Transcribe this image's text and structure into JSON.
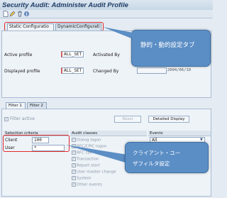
{
  "window": {
    "title": "Security Audit: Administer Audit Profile"
  },
  "toolbar": {
    "icons": [
      "new-document-icon",
      "edit-icon",
      "delete-icon",
      "info-icon"
    ]
  },
  "upper_tabs": [
    {
      "label": "Static Configuratio"
    },
    {
      "label": "DynamicConfigurati"
    }
  ],
  "profile": {
    "active_label": "Active profile",
    "active_value": "ALL_SET",
    "activated_by_label": "Activated By",
    "displayed_label": "Displayed profile",
    "displayed_value": "ALL_SET",
    "changed_by_label": "Changed By",
    "changed_date": "2004/06/10"
  },
  "callouts": {
    "top": "静的・動的設定タブ",
    "bottom_line1": "クライアント・ユー",
    "bottom_line2": "ザフィルタ設定"
  },
  "filter_tabs": [
    {
      "label": "Filter 1"
    },
    {
      "label": "Filter 2"
    }
  ],
  "filter": {
    "active_label": "Filter active",
    "reset_label": "Reset",
    "detailed_label": "Detailed Display",
    "selection_header": "Selection criteria",
    "client_label": "Client",
    "client_value": "100",
    "user_label": "User",
    "user_value": "*",
    "audit_header": "Audit classes",
    "audit_classes": [
      "Dialog logon",
      "RFC/CPIC logon",
      "RFC call",
      "Transaction",
      "Report start",
      "User master change",
      "System",
      "Other events"
    ],
    "events_header": "Events",
    "events_value": "All"
  },
  "colors": {
    "callout": "#5b8ec5",
    "highlight": "#e02b2b",
    "title": "#1f3d66"
  }
}
